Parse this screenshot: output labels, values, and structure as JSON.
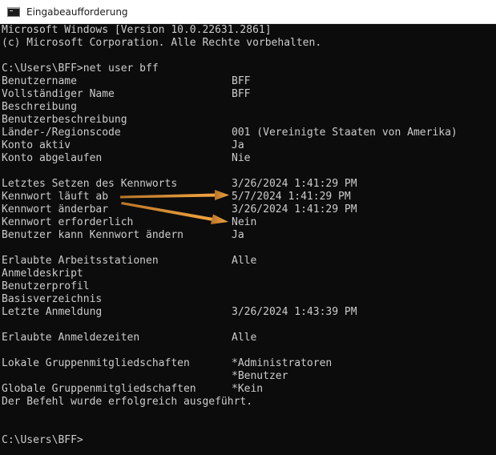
{
  "window": {
    "title": "Eingabeaufforderung",
    "icon": "console-icon"
  },
  "console": {
    "line1": "Microsoft Windows [Version 10.0.22631.2861]",
    "line2": "(c) Microsoft Corporation. Alle Rechte vorbehalten.",
    "command_line": "C:\\Users\\BFF>net user bff",
    "fields": {
      "benutzername": {
        "label": "Benutzername",
        "value": "BFF"
      },
      "vollstaendiger_name": {
        "label": "Vollständiger Name",
        "value": "BFF"
      },
      "beschreibung": {
        "label": "Beschreibung",
        "value": ""
      },
      "benutzerbeschreibung": {
        "label": "Benutzerbeschreibung",
        "value": ""
      },
      "regionscode": {
        "label": "Länder-/Regionscode",
        "value": "001 (Vereinigte Staaten von Amerika)"
      },
      "konto_aktiv": {
        "label": "Konto aktiv",
        "value": "Ja"
      },
      "konto_abgelaufen": {
        "label": "Konto abgelaufen",
        "value": "Nie"
      },
      "letztes_setzen": {
        "label": "Letztes Setzen des Kennworts",
        "value": "3/26/2024 1:41:29 PM"
      },
      "kennwort_laeuft_ab": {
        "label": "Kennwort läuft ab",
        "value": "5/7/2024 1:41:29 PM"
      },
      "kennwort_aenderbar": {
        "label": "Kennwort änderbar",
        "value": "3/26/2024 1:41:29 PM"
      },
      "kennwort_erforderlich": {
        "label": "Kennwort erforderlich",
        "value": "Nein"
      },
      "benutzer_kann_aendern": {
        "label": "Benutzer kann Kennwort ändern",
        "value": "Ja"
      },
      "arbeitsstationen": {
        "label": "Erlaubte Arbeitsstationen",
        "value": "Alle"
      },
      "anmeldeskript": {
        "label": "Anmeldeskript",
        "value": ""
      },
      "benutzerprofil": {
        "label": "Benutzerprofil",
        "value": ""
      },
      "basisverzeichnis": {
        "label": "Basisverzeichnis",
        "value": ""
      },
      "letzte_anmeldung": {
        "label": "Letzte Anmeldung",
        "value": "3/26/2024 1:43:39 PM"
      },
      "anmeldezeiten": {
        "label": "Erlaubte Anmeldezeiten",
        "value": "Alle"
      },
      "lokale_gruppen": {
        "label": "Lokale Gruppenmitgliedschaften",
        "value": "*Administratoren"
      },
      "lokale_gruppen_2": {
        "label": "",
        "value": "*Benutzer"
      },
      "globale_gruppen": {
        "label": "Globale Gruppenmitgliedschaften",
        "value": "*Kein"
      }
    },
    "success_message": "Der Befehl wurde erfolgreich ausgeführt.",
    "prompt": "C:\\Users\\BFF>"
  },
  "colors": {
    "background": "#0c0c0c",
    "text": "#cccccc",
    "annotation_arrow": "#f0a040"
  }
}
